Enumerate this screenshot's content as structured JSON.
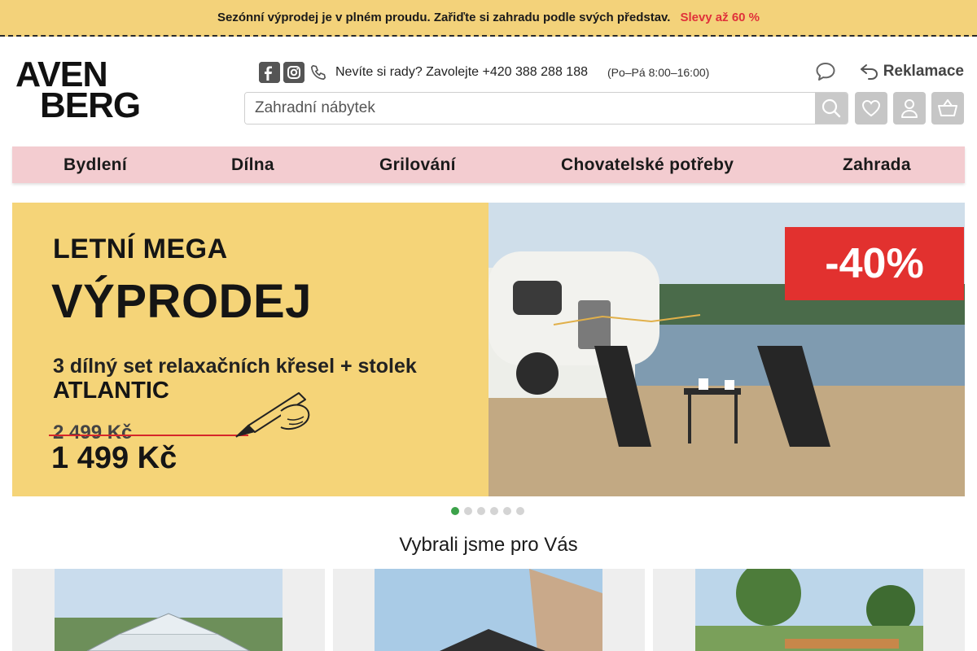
{
  "promo": {
    "text": "Sezónní výprodej je v plném proudu. Zařiďte si zahradu podle svých představ.",
    "link": "Slevy až 60 %"
  },
  "logo": {
    "line1": "AVEN",
    "line2": "BERG"
  },
  "header": {
    "contact_text": "Nevíte si rady? Zavolejte +420 388 288 188",
    "contact_hours": "(Po–Pá 8:00–16:00)",
    "reklamace_label": "Reklamace"
  },
  "search": {
    "placeholder": "Zahradní nábytek"
  },
  "icons": {
    "facebook": "facebook-icon",
    "instagram": "instagram-icon",
    "phone": "phone-icon",
    "chat": "chat-icon",
    "return": "return-arrow-icon",
    "search": "search-icon",
    "wishlist": "heart-icon",
    "account": "user-icon",
    "cart": "basket-icon"
  },
  "nav": {
    "items": [
      {
        "label": "Bydlení"
      },
      {
        "label": "Dílna"
      },
      {
        "label": "Grilování"
      },
      {
        "label": "Chovatelské potřeby"
      },
      {
        "label": "Zahrada"
      }
    ]
  },
  "banner": {
    "line1": "LETNÍ MEGA",
    "line2": "VÝPRODEJ",
    "line3": "3 dílný set relaxačních křesel + stolek",
    "line4": "ATLANTIC",
    "old_price": "2 499 Kč",
    "new_price": "1 499 Kč",
    "badge": "-40%"
  },
  "carousel": {
    "count": 6,
    "active": 0
  },
  "section": {
    "title": "Vybrali jsme pro Vás"
  },
  "colors": {
    "promo_bg": "#f3d27a",
    "promo_link": "#e0313a",
    "nav_bg": "#f3ccd0",
    "banner_yellow": "#f5d478",
    "badge_red": "#e2312f",
    "dot_active": "#3ca24a"
  }
}
